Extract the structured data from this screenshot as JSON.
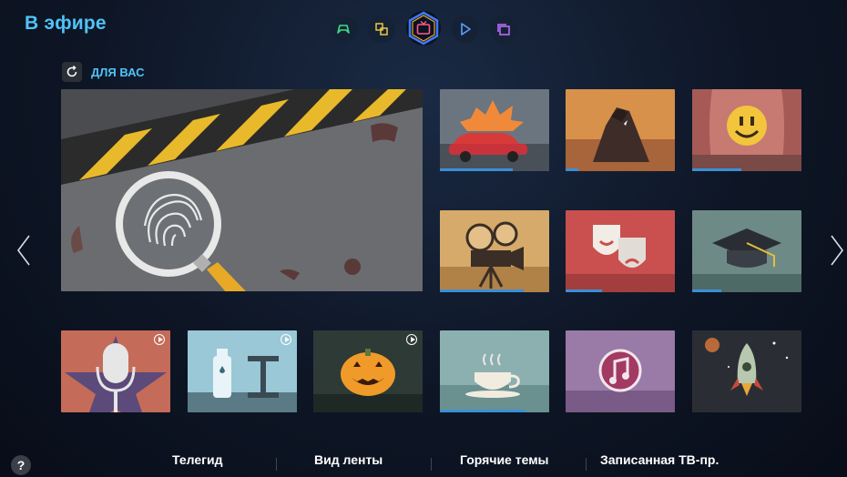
{
  "header": {
    "title": "В эфире"
  },
  "top_nav": [
    {
      "icon": "gamepad-icon",
      "active": false
    },
    {
      "icon": "multiscreen-icon",
      "active": false
    },
    {
      "icon": "tv-icon",
      "active": true
    },
    {
      "icon": "play-icon",
      "active": false
    },
    {
      "icon": "apps-icon",
      "active": false
    }
  ],
  "section": {
    "label": "ДЛЯ ВАС",
    "icon": "refresh-icon"
  },
  "tiles": [
    {
      "name": "featured-tile-fingerprint",
      "progress": null
    },
    {
      "name": "tile-car-action",
      "progress": 0.67
    },
    {
      "name": "tile-dark-silhouette",
      "progress": 0.12
    },
    {
      "name": "tile-smiley-stage",
      "progress": 0.45
    },
    {
      "name": "tile-film-camera",
      "progress": 0.77
    },
    {
      "name": "tile-theatre-masks",
      "progress": 0.33
    },
    {
      "name": "tile-graduation-cap",
      "progress": 0.27
    },
    {
      "name": "tile-microphone",
      "progress": null,
      "badge": "play"
    },
    {
      "name": "tile-fitness",
      "progress": null,
      "badge": "play"
    },
    {
      "name": "tile-halloween-pumpkin",
      "progress": null,
      "badge": "play"
    },
    {
      "name": "tile-coffee-cup",
      "progress": 0.78
    },
    {
      "name": "tile-music-note",
      "progress": null
    },
    {
      "name": "tile-rocket-space",
      "progress": null
    }
  ],
  "bottom_menu": [
    "Телегид",
    "Вид ленты",
    "Горячие темы",
    "Записанная ТВ-пр."
  ],
  "help": "?",
  "colors": {
    "accent": "#4fc3f7",
    "progress": "#3b8fd6"
  }
}
